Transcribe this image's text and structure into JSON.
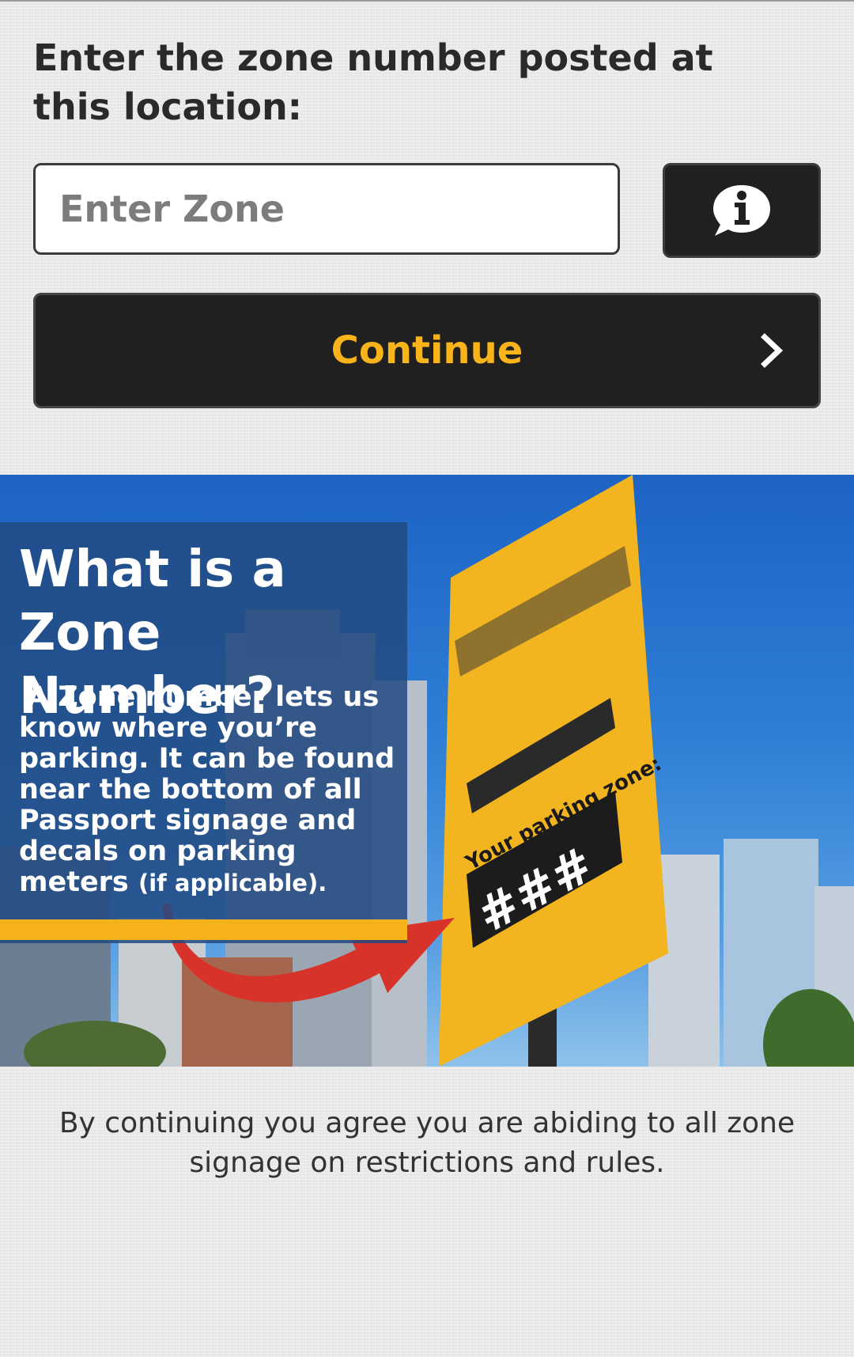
{
  "zone_form": {
    "prompt": "Enter the zone number posted at this location:",
    "zone_input_placeholder": "Enter Zone",
    "zone_input_value": "",
    "info_button_icon": "info-icon",
    "continue_label": "Continue",
    "continue_icon": "chevron-right-icon"
  },
  "help_banner": {
    "title_line1": "What is a",
    "title_line2": "Zone Number?",
    "body": "A Zone number lets us know where you’re parking. It can be found near the bottom of all Passport signage and decals on parking meters",
    "body_note": "(if applicable).",
    "sign_caption": "Your parking zone:",
    "sign_zone": "###"
  },
  "footer": {
    "disclaimer": "By continuing you agree you are abiding to all zone signage on restrictions and rules."
  },
  "colors": {
    "accent": "#f9b31b",
    "button_background": "#202020",
    "page_background": "#e9e9e9",
    "banner_sky": "#2f7fd6"
  }
}
